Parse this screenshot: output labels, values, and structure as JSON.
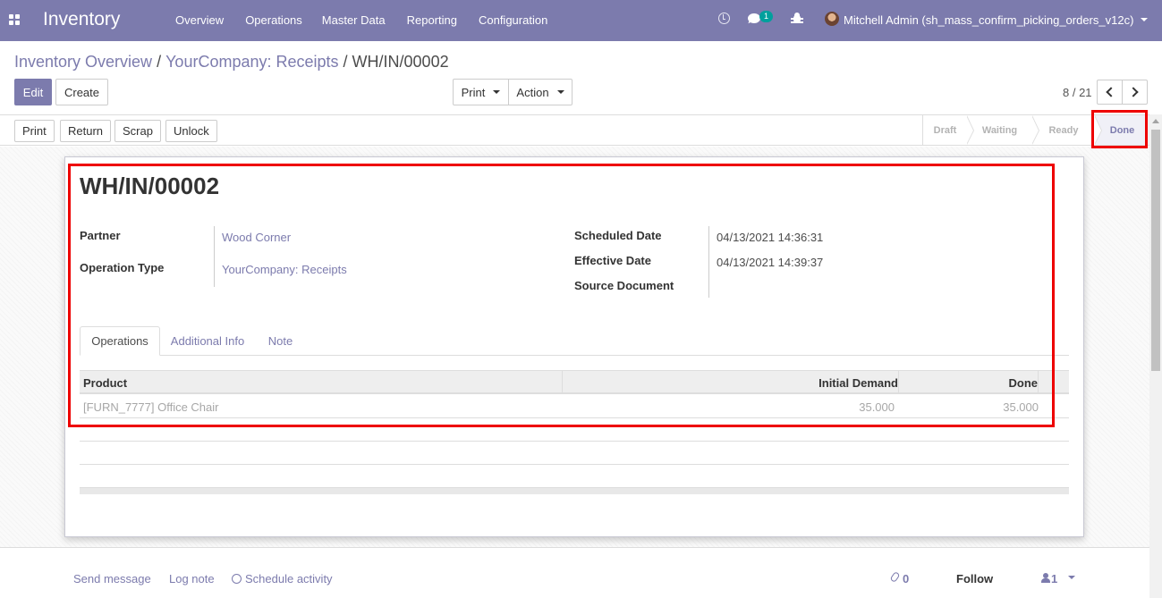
{
  "navbar": {
    "brand": "Inventory",
    "menu": [
      "Overview",
      "Operations",
      "Master Data",
      "Reporting",
      "Configuration"
    ],
    "chat_badge": "1",
    "user": "Mitchell Admin (sh_mass_confirm_picking_orders_v12c)",
    "bg_color": "#7c7bad"
  },
  "breadcrumb": {
    "items": [
      "Inventory Overview",
      "YourCompany: Receipts"
    ],
    "current": "WH/IN/00002",
    "separator": "/"
  },
  "toolbar": {
    "edit": "Edit",
    "create": "Create",
    "print": "Print",
    "action": "Action"
  },
  "pager": {
    "value": "8 / 21"
  },
  "statusbar": {
    "buttons": [
      "Print",
      "Return",
      "Scrap",
      "Unlock"
    ],
    "stages": [
      "Draft",
      "Waiting",
      "Ready",
      "Done"
    ],
    "active_stage": "Done"
  },
  "form": {
    "title": "WH/IN/00002",
    "partner_label": "Partner",
    "partner": "Wood Corner",
    "operation_type_label": "Operation Type",
    "operation_type": "YourCompany: Receipts",
    "scheduled_date_label": "Scheduled Date",
    "scheduled_date": "04/13/2021 14:36:31",
    "effective_date_label": "Effective Date",
    "effective_date": "04/13/2021 14:39:37",
    "source_document_label": "Source Document",
    "source_document": ""
  },
  "tabs": [
    "Operations",
    "Additional Info",
    "Note"
  ],
  "table": {
    "columns": [
      "Product",
      "Initial Demand",
      "Done"
    ],
    "rows": [
      {
        "product": "[FURN_7777] Office Chair",
        "initial_demand": "35.000",
        "done": "35.000"
      }
    ]
  },
  "chatter": {
    "send_message": "Send message",
    "log_note": "Log note",
    "schedule_activity": "Schedule activity",
    "attachments": "0",
    "follow": "Follow",
    "followers": "1"
  },
  "highlight_color": "#e00000"
}
